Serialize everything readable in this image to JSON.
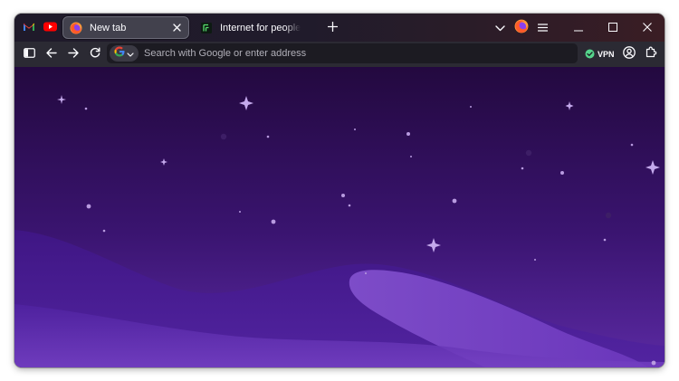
{
  "tabs": {
    "pinned": [
      {
        "name": "Gmail",
        "icon": "gmail-icon"
      },
      {
        "name": "YouTube",
        "icon": "youtube-icon"
      }
    ],
    "active": {
      "title": "New tab",
      "icon": "firefox-icon"
    },
    "inactive": {
      "title": "Internet for people, not profit",
      "icon": "mozilla-icon"
    }
  },
  "navbar": {
    "search_placeholder": "Search with Google or enter address",
    "engine_icon": "google-icon",
    "vpn_label": "VPN"
  },
  "colors": {
    "sky_top": "#23093f",
    "sky_bottom": "#6a33b8",
    "tab_active": "#42414d",
    "toolbar": "#2b2a33",
    "urlbar": "#1c1b22"
  }
}
